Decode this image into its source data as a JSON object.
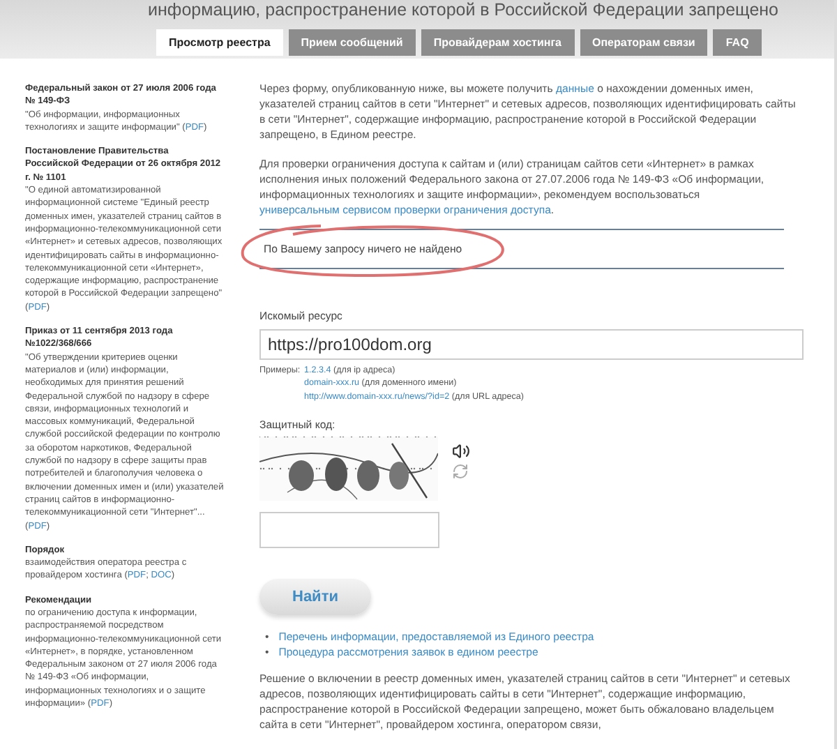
{
  "header": {
    "title": "информацию, распространение которой в Российской Федерации запрещено"
  },
  "tabs": [
    {
      "label": "Просмотр реестра",
      "selected": true
    },
    {
      "label": "Прием сообщений",
      "selected": false
    },
    {
      "label": "Провайдерам хостинга",
      "selected": false
    },
    {
      "label": "Операторам связи",
      "selected": false
    },
    {
      "label": "FAQ",
      "selected": false
    }
  ],
  "sidebar": {
    "documents": [
      {
        "title": "Федеральный закон от 27 июля 2006 года № 149-ФЗ",
        "body": [
          {
            "kind": "text",
            "text": "\"Об информации, информационных технологиях и защите информации\" ("
          },
          {
            "kind": "link",
            "text": "PDF"
          },
          {
            "kind": "text",
            "text": ")"
          }
        ]
      },
      {
        "title": "Постановление Правительства Российской Федерации от 26 октября 2012 г. № 1101",
        "body": [
          {
            "kind": "text",
            "text": "\"О единой автоматизированной информационной системе \"Единый реестр доменных имен, указателей страниц сайтов в информационно-телекоммуникационной сети «Интернет» и сетевых адресов, позволяющих идентифицировать сайты в информационно-телекоммуникационной сети «Интернет», содержащие информацию, распространение которой в Российской Федерации запрещено\" ("
          },
          {
            "kind": "link",
            "text": "PDF"
          },
          {
            "kind": "text",
            "text": ")"
          }
        ]
      },
      {
        "title": "Приказ от 11 сентября 2013 года №1022/368/666",
        "body": [
          {
            "kind": "text",
            "text": "\"Об утверждении критериев оценки материалов и (или) информации, необходимых для принятия решений Федеральной службой по надзору в сфере связи, информационных технологий и массовых коммуникаций, Федеральной службой российской федерации по контролю за оборотом наркотиков, Федеральной службой по надзору в сфере защиты прав потребителей и благополучия человека о включении доменных имен и (или) указателей страниц сайтов в информационно-телекоммуникационной сети \"Интернет\"... ("
          },
          {
            "kind": "link",
            "text": "PDF"
          },
          {
            "kind": "text",
            "text": ")"
          }
        ]
      },
      {
        "title": "Порядок",
        "body": [
          {
            "kind": "text",
            "text": "взаимодействия оператора реестра с провайдером хостинга ("
          },
          {
            "kind": "link",
            "text": "PDF"
          },
          {
            "kind": "text",
            "text": "; "
          },
          {
            "kind": "link",
            "text": "DOC"
          },
          {
            "kind": "text",
            "text": ")"
          }
        ]
      },
      {
        "title": "Рекомендации",
        "body": [
          {
            "kind": "text",
            "text": "по ограничению доступа к информации, распространяемой посредством информационно-телекоммуникационной сети «Интернет», в порядке, установленном Федеральным законом от 27 июля 2006 года № 149-ФЗ «Об информации, информационных технологиях и о защите информации» ("
          },
          {
            "kind": "link",
            "text": "PDF"
          },
          {
            "kind": "text",
            "text": ")"
          }
        ]
      }
    ]
  },
  "intro": [
    [
      {
        "kind": "text",
        "text": "Через форму, опубликованную ниже, вы можете получить "
      },
      {
        "kind": "link",
        "text": "данные"
      },
      {
        "kind": "text",
        "text": " о нахождении доменных имен, указателей страниц сайтов в сети \"Интернет\" и сетевых адресов, позволяющих идентифицировать сайты в сети \"Интернет\", содержащие информацию, распространение которой в Российской Федерации запрещено, в Едином реестре."
      }
    ],
    [
      {
        "kind": "text",
        "text": "Для проверки ограничения доступа к сайтам и (или) страницам сайтов сети «Интернет» в рамках исполнения иных положений Федерального закона от 27.07.2006 года № 149-ФЗ «Об информации, информационных технологиях и защите информации», рекомендуем воспользоваться "
      },
      {
        "kind": "link",
        "text": "универсальным сервисом проверки ограничения доступа"
      },
      {
        "kind": "text",
        "text": "."
      }
    ]
  ],
  "result": {
    "message": "По Вашему запросу ничего не найдено",
    "circled": true
  },
  "search": {
    "label": "Искомый ресурс",
    "value": "https://pro100dom.org"
  },
  "examples": {
    "label": "Примеры:",
    "items": [
      {
        "link": "1.2.3.4",
        "note": "(для ip адреса)"
      },
      {
        "link": "domain-xxx.ru",
        "note": "(для доменного имени)"
      },
      {
        "link": "http://www.domain-xxx.ru/news/?id=2",
        "note": "(для URL адреса)"
      }
    ]
  },
  "captcha": {
    "label": "Защитный код:"
  },
  "submit": {
    "label": "Найти"
  },
  "links": [
    {
      "bullet": "•",
      "text": "Перечень информации, предоставляемой из Единого реестра"
    },
    {
      "bullet": "•",
      "text": "Процедура рассмотрения заявок в едином реестре"
    }
  ],
  "footer_text": "Решение о включении в реестр доменных имен, указателей страниц сайтов в сети \"Интернет\" и сетевых адресов, позволяющих идентифицировать сайты в сети \"Интернет\", содержащие информацию, распространение которой в Российской Федерации запрещено, может быть обжаловано владельцем сайта в сети \"Интернет\", провайдером хостинга, оператором связи,"
}
